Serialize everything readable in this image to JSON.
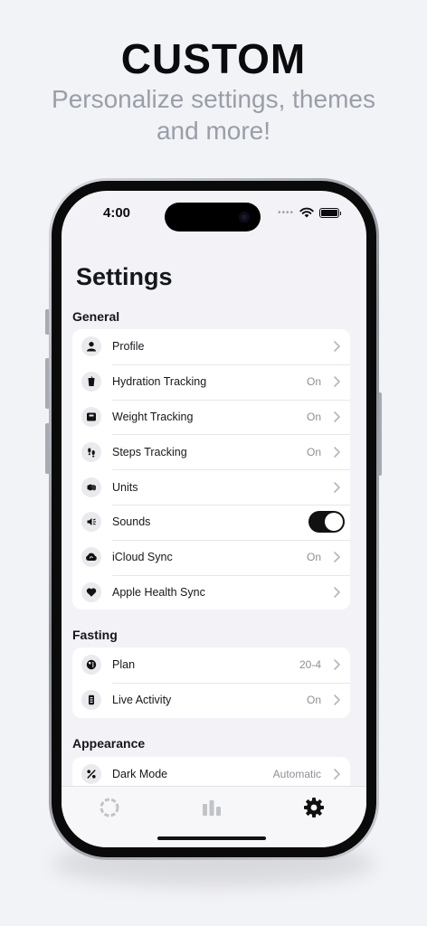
{
  "promo": {
    "title": "CUSTOM",
    "subtitle": "Personalize settings, themes and more!"
  },
  "status_bar": {
    "time": "4:00",
    "icons": [
      "signal-dots-icon",
      "wifi-icon",
      "battery-icon"
    ]
  },
  "page": {
    "title": "Settings"
  },
  "sections": {
    "general": {
      "title": "General",
      "items": [
        {
          "label": "Profile",
          "value": "",
          "icon": "person-icon"
        },
        {
          "label": "Hydration Tracking",
          "value": "On",
          "icon": "cup-icon"
        },
        {
          "label": "Weight Tracking",
          "value": "On",
          "icon": "scale-icon"
        },
        {
          "label": "Steps Tracking",
          "value": "On",
          "icon": "footsteps-icon"
        },
        {
          "label": "Units",
          "value": "",
          "icon": "cubes-icon"
        },
        {
          "label": "Sounds",
          "value": "",
          "icon": "speaker-icon",
          "toggle": true
        },
        {
          "label": "iCloud Sync",
          "value": "On",
          "icon": "cloud-sync-icon"
        },
        {
          "label": "Apple Health Sync",
          "value": "",
          "icon": "heart-icon"
        }
      ]
    },
    "fasting": {
      "title": "Fasting",
      "items": [
        {
          "label": "Plan",
          "value": "20-4",
          "icon": "plate-clock-icon"
        },
        {
          "label": "Live Activity",
          "value": "On",
          "icon": "phone-activity-icon"
        }
      ]
    },
    "appearance": {
      "title": "Appearance",
      "items": [
        {
          "label": "Dark Mode",
          "value": "Automatic",
          "icon": "percent-icon"
        }
      ]
    }
  },
  "tabbar": {
    "tabs": [
      {
        "icon": "ring-progress-icon",
        "active": false
      },
      {
        "icon": "bar-chart-icon",
        "active": false
      },
      {
        "icon": "gear-icon",
        "active": true
      }
    ]
  },
  "colors": {
    "background": "#f2f3f7",
    "card": "#ffffff",
    "accent": "#111111",
    "muted": "#8d8f96"
  }
}
